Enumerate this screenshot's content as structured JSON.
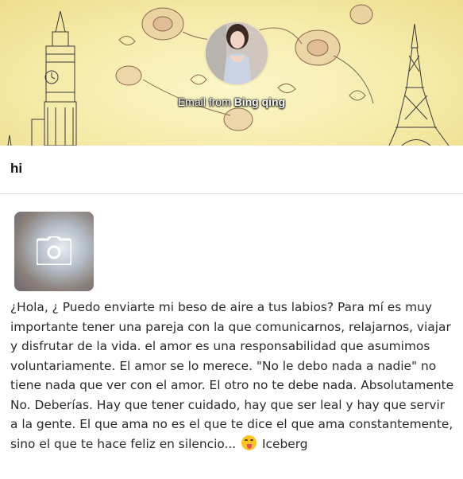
{
  "header": {
    "caption_prefix": "Email from",
    "sender_name": "Bing qing"
  },
  "email": {
    "subject": "hi",
    "body": "¿Hola, ¿ Puedo enviarte mi beso de aire a tus labios? Para mí es muy importante tener una pareja con la que comunicarnos, relajarnos, viajar y disfrutar de la vida. el amor es una responsabilidad que asumimos voluntariamente. El amor se lo merece. \"No le debo nada a nadie\" no tiene nada que ver con el amor. El otro no te debe nada. Absolutamente No. Deberías. Hay que tener cuidado, hay que ser leal y hay que servir a la gente. El que ama no es el que te dice el que ama constantemente, sino el que te hace feliz en silencio...",
    "signature": "Iceberg",
    "emoji": "face-savoring-food-emoji"
  },
  "icons": {
    "attachment": "camera-icon"
  }
}
